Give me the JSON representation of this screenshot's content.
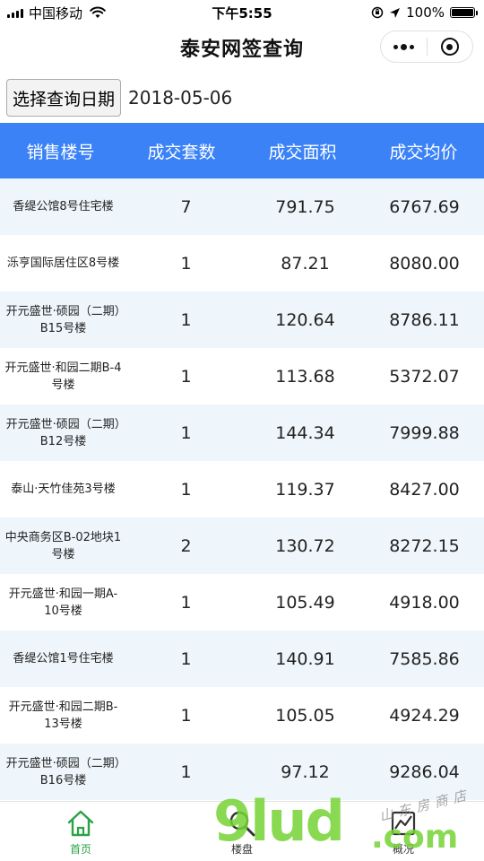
{
  "status_bar": {
    "carrier": "中国移动",
    "time": "下午5:55",
    "battery": "100%"
  },
  "nav": {
    "title": "泰安网签查询"
  },
  "date_picker": {
    "button_label": "选择查询日期",
    "value": "2018-05-06"
  },
  "table": {
    "headers": [
      "销售楼号",
      "成交套数",
      "成交面积",
      "成交均价"
    ],
    "rows": [
      {
        "name": "香缇公馆8号住宅楼",
        "count": "7",
        "area": "791.75",
        "price": "6767.69"
      },
      {
        "name": "泺亨国际居住区8号楼",
        "count": "1",
        "area": "87.21",
        "price": "8080.00"
      },
      {
        "name": "开元盛世·硕园（二期）B15号楼",
        "count": "1",
        "area": "120.64",
        "price": "8786.11"
      },
      {
        "name": "开元盛世·和园二期B-4号楼",
        "count": "1",
        "area": "113.68",
        "price": "5372.07"
      },
      {
        "name": "开元盛世·硕园（二期）B12号楼",
        "count": "1",
        "area": "144.34",
        "price": "7999.88"
      },
      {
        "name": "泰山·天竹佳苑3号楼",
        "count": "1",
        "area": "119.37",
        "price": "8427.00"
      },
      {
        "name": "中央商务区B-02地块1号楼",
        "count": "2",
        "area": "130.72",
        "price": "8272.15"
      },
      {
        "name": "开元盛世·和园一期A-10号楼",
        "count": "1",
        "area": "105.49",
        "price": "4918.00"
      },
      {
        "name": "香缇公馆1号住宅楼",
        "count": "1",
        "area": "140.91",
        "price": "7585.86"
      },
      {
        "name": "开元盛世·和园二期B-13号楼",
        "count": "1",
        "area": "105.05",
        "price": "4924.29"
      },
      {
        "name": "开元盛世·硕园（二期）B16号楼",
        "count": "1",
        "area": "97.12",
        "price": "9286.04"
      }
    ]
  },
  "tabbar": {
    "tabs": [
      {
        "label": "首页",
        "icon": "home-icon",
        "active": true
      },
      {
        "label": "楼盘",
        "icon": "search-icon",
        "active": false
      },
      {
        "label": "概况",
        "icon": "chart-icon",
        "active": false
      }
    ]
  },
  "watermark": {
    "big": "9lud",
    "com": ".com",
    "small": "山东房商店"
  },
  "colors": {
    "header_blue": "#3b82f7",
    "row_tint": "#eef6fb",
    "tab_active": "#2ba245"
  }
}
